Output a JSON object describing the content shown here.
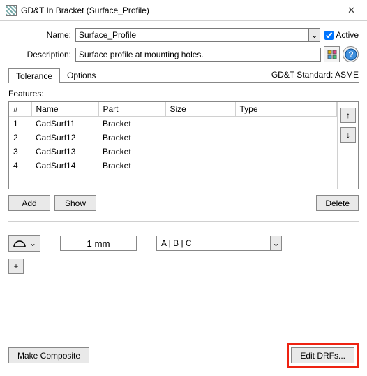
{
  "window": {
    "title": "GD&T In Bracket (Surface_Profile)"
  },
  "form": {
    "name_label": "Name:",
    "name_value": "Surface_Profile",
    "active_label": "Active",
    "description_label": "Description:",
    "description_value": "Surface profile at mounting holes."
  },
  "tabs": {
    "tolerance": "Tolerance",
    "options": "Options"
  },
  "standard": "GD&T Standard: ASME",
  "features": {
    "label": "Features:",
    "columns": {
      "num": "#",
      "name": "Name",
      "part": "Part",
      "size": "Size",
      "type": "Type"
    },
    "rows": [
      {
        "num": "1",
        "name": "CadSurf11",
        "part": "Bracket",
        "size": "",
        "type": ""
      },
      {
        "num": "2",
        "name": "CadSurf12",
        "part": "Bracket",
        "size": "",
        "type": ""
      },
      {
        "num": "3",
        "name": "CadSurf13",
        "part": "Bracket",
        "size": "",
        "type": ""
      },
      {
        "num": "4",
        "name": "CadSurf14",
        "part": "Bracket",
        "size": "",
        "type": ""
      }
    ],
    "buttons": {
      "add": "Add",
      "show": "Show",
      "delete": "Delete"
    }
  },
  "tolerance": {
    "symbol": "surface-profile",
    "value": "1 mm",
    "drf": "A | B | C"
  },
  "bottom": {
    "make_composite": "Make Composite",
    "edit_drfs": "Edit DRFs..."
  },
  "glyphs": {
    "up": "↑",
    "down": "↓",
    "plus": "+",
    "close": "✕",
    "caret": "⌄"
  }
}
